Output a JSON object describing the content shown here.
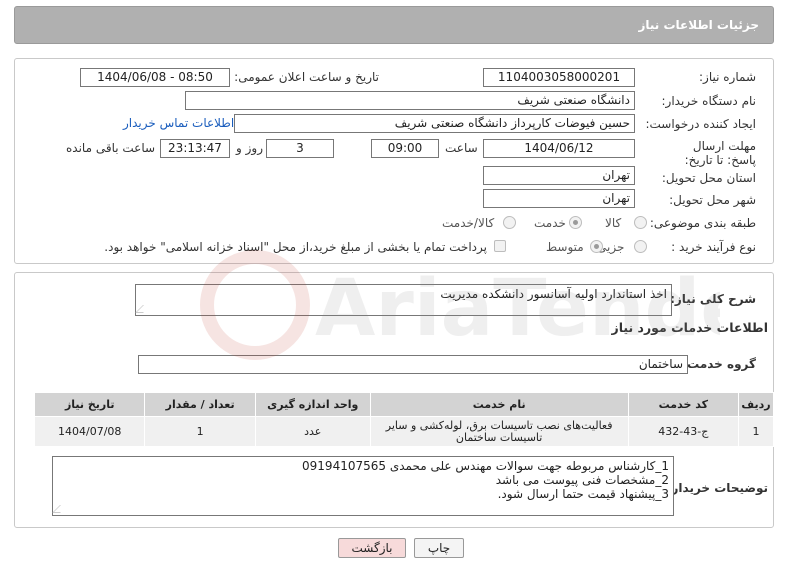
{
  "page": {
    "title": "جزئیات اطلاعات نیاز"
  },
  "labels": {
    "need_number": "شماره نیاز:",
    "public_announce": "تاریخ و ساعت اعلان عمومی:",
    "buyer_org": "نام دستگاه خریدار:",
    "creator": "ایجاد کننده درخواست:",
    "deadline": "مهلت ارسال پاسخ: تا تاریخ:",
    "deadline_time": "ساعت",
    "days": "روز و",
    "remaining": "ساعت باقی مانده",
    "province": "استان محل تحویل:",
    "city": "شهر محل تحویل:",
    "category": "طبقه بندی موضوعی:",
    "purchase_type": "نوع فرآیند خرید :",
    "summary": "شرح کلی نیاز:",
    "services_info": "اطلاعات خدمات مورد نیاز",
    "service_group": "گروه خدمت:",
    "buyer_notes": "توضیحات خریدار:"
  },
  "fields": {
    "need_number": "1104003058000201",
    "public_announce": "1404/06/08 - 08:50",
    "buyer_org": "دانشگاه صنعتی شریف",
    "creator": "حسین فیوضات کارپرداز دانشگاه صنعتی شریف",
    "contact_link": "اطلاعات تماس خریدار",
    "deadline_date": "1404/06/12",
    "deadline_time": "09:00",
    "days": "3",
    "remaining_time": "23:13:47",
    "province": "تهران",
    "city": "تهران",
    "summary": "اخذ استاندارد اولیه آسانسور دانشکده مدیریت",
    "service_group": "ساختمان"
  },
  "category_options": [
    {
      "label": "کالا",
      "selected": false
    },
    {
      "label": "خدمت",
      "selected": true
    },
    {
      "label": "کالا/خدمت",
      "selected": false
    }
  ],
  "purchase_options": [
    {
      "label": "جزیی",
      "selected": false
    },
    {
      "label": "متوسط",
      "selected": true
    }
  ],
  "payment_note": "پرداخت تمام یا بخشی از مبلغ خرید،از محل \"اسناد خزانه اسلامی\" خواهد بود.",
  "table": {
    "headers": [
      "ردیف",
      "کد خدمت",
      "نام خدمت",
      "واحد اندازه گیری",
      "تعداد / مقدار",
      "تاریخ نیاز"
    ],
    "rows": [
      [
        "1",
        "ج-43-432",
        "فعالیت‌های نصب تاسیسات برق، لوله‌کشی و سایر تاسیسات ساختمان",
        "عدد",
        "1",
        "1404/07/08"
      ]
    ]
  },
  "notes": [
    "1_کارشناس مربوطه جهت سوالات مهندس علی محمدی 09194107565",
    "2_مشخصات فنی پیوست می باشد",
    "3_پیشنهاد قیمت حتما ارسال شود."
  ],
  "buttons": {
    "print": "چاپ",
    "back": "بازگشت"
  },
  "watermark": {
    "text": "AriaTender.neT"
  },
  "colors": {
    "title_bar": "#b0b0b0",
    "link": "#1a5dbd",
    "back_button": "#f7dada",
    "watermark": "#c0392b"
  }
}
